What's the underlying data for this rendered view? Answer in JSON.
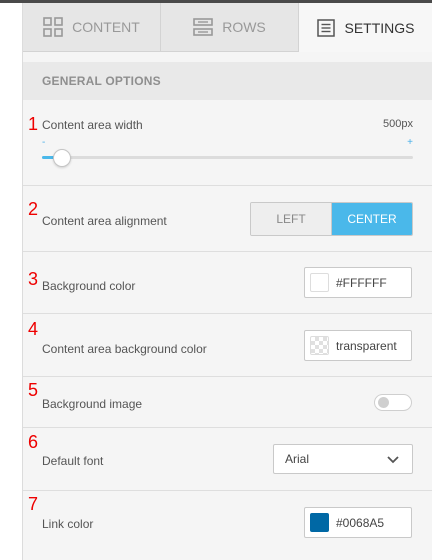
{
  "tabs": [
    {
      "label": "CONTENT",
      "icon": "grid-icon"
    },
    {
      "label": "ROWS",
      "icon": "rows-icon"
    },
    {
      "label": "SETTINGS",
      "icon": "settings-document-icon",
      "active": true
    }
  ],
  "section": {
    "title": "GENERAL OPTIONS"
  },
  "settings": {
    "content_width": {
      "number": "1",
      "label": "Content area width",
      "value": "500px",
      "min_label": "-",
      "max_label": "+",
      "slider_fraction": 0.05
    },
    "alignment": {
      "number": "2",
      "label": "Content area alignment",
      "options": [
        "LEFT",
        "CENTER"
      ],
      "selected": "CENTER"
    },
    "background_color": {
      "number": "3",
      "label": "Background color",
      "value": "#FFFFFF",
      "swatch": "#FFFFFF"
    },
    "content_bg_color": {
      "number": "4",
      "label": "Content area background color",
      "value": "transparent"
    },
    "background_image": {
      "number": "5",
      "label": "Background image",
      "enabled": false
    },
    "default_font": {
      "number": "6",
      "label": "Default font",
      "value": "Arial"
    },
    "link_color": {
      "number": "7",
      "label": "Link color",
      "value": "#0068A5",
      "swatch": "#0068A5"
    }
  },
  "colors": {
    "accent": "#4AB8EA",
    "annotation": "#EE0000"
  }
}
